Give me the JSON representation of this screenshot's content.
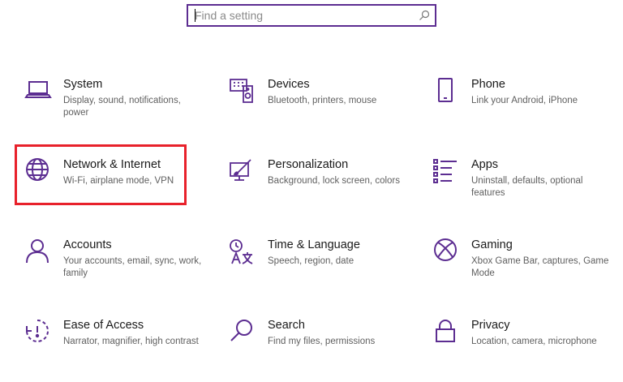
{
  "search": {
    "placeholder": "Find a setting",
    "value": ""
  },
  "categories": [
    {
      "title": "System",
      "desc": "Display, sound, notifications, power",
      "icon": "laptop-icon"
    },
    {
      "title": "Devices",
      "desc": "Bluetooth, printers, mouse",
      "icon": "keyboard-speaker-icon"
    },
    {
      "title": "Phone",
      "desc": "Link your Android, iPhone",
      "icon": "phone-icon"
    },
    {
      "title": "Network & Internet",
      "desc": "Wi-Fi, airplane mode, VPN",
      "icon": "globe-icon"
    },
    {
      "title": "Personalization",
      "desc": "Background, lock screen, colors",
      "icon": "paintbrush-icon"
    },
    {
      "title": "Apps",
      "desc": "Uninstall, defaults, optional features",
      "icon": "apps-list-icon"
    },
    {
      "title": "Accounts",
      "desc": "Your accounts, email, sync, work, family",
      "icon": "person-icon"
    },
    {
      "title": "Time & Language",
      "desc": "Speech, region, date",
      "icon": "time-language-icon"
    },
    {
      "title": "Gaming",
      "desc": "Xbox Game Bar, captures, Game Mode",
      "icon": "xbox-icon"
    },
    {
      "title": "Ease of Access",
      "desc": "Narrator, magnifier, high contrast",
      "icon": "ease-of-access-icon"
    },
    {
      "title": "Search",
      "desc": "Find my files, permissions",
      "icon": "magnifier-icon"
    },
    {
      "title": "Privacy",
      "desc": "Location, camera, microphone",
      "icon": "lock-icon"
    }
  ],
  "colors": {
    "accent": "#5c2d91",
    "highlight": "#e8212b"
  }
}
